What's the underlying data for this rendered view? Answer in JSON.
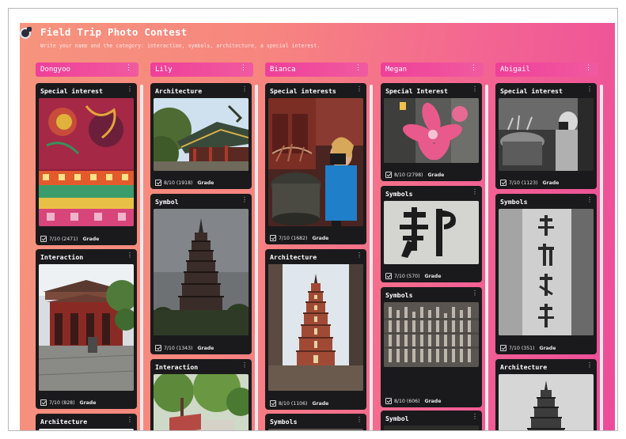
{
  "app": {
    "title": "Field Trip Photo Contest",
    "subtitle": "Write your name and the category: interaction, symbols, architecture, a special interest."
  },
  "colors": {
    "accent": "#ef3f9a",
    "card": "#1a1a1c",
    "bg_start": "#f6947d",
    "bg_end": "#ec4c9a"
  },
  "columns": [
    {
      "name": "Dongyoo",
      "posts": [
        {
          "category": "Special interest",
          "rating": "7/10 (2471)",
          "grade_label": "Grade",
          "image": "embroidered-fabric"
        },
        {
          "category": "Interaction",
          "rating": "7/10 (828)",
          "grade_label": "Grade",
          "image": "temple-courtyard"
        },
        {
          "category": "Architecture"
        }
      ]
    },
    {
      "name": "Lily",
      "posts": [
        {
          "category": "Architecture",
          "rating": "8/10 (1918)",
          "grade_label": "Grade",
          "image": "temple-roof"
        },
        {
          "category": "Symbol",
          "rating": "7/10 (1343)",
          "grade_label": "Grade",
          "image": "pagoda"
        },
        {
          "category": "Interaction",
          "image": "tree-garden"
        }
      ]
    },
    {
      "name": "Bianca",
      "posts": [
        {
          "category": "Special interests",
          "rating": "7/10 (1682)",
          "grade_label": "Grade",
          "image": "photographer-incense"
        },
        {
          "category": "Architecture",
          "rating": "8/10 (1106)",
          "grade_label": "Grade",
          "image": "pagoda-color"
        },
        {
          "category": "Symbols"
        }
      ]
    },
    {
      "name": "Megan",
      "posts": [
        {
          "category": "Special Interest",
          "rating": "8/10 (2798)",
          "grade_label": "Grade",
          "image": "pink-lily"
        },
        {
          "category": "Symbols",
          "rating": "7/10 (570)",
          "grade_label": "Grade",
          "image": "chinese-character"
        },
        {
          "category": "Symbols",
          "rating": "8/10 (606)",
          "grade_label": "Grade",
          "image": "stone-inscription"
        },
        {
          "category": "Symbol"
        }
      ]
    },
    {
      "name": "Abigail",
      "posts": [
        {
          "category": "Special interest",
          "rating": "7/10 (1123)",
          "grade_label": "Grade",
          "image": "photographer-bw"
        },
        {
          "category": "Symbols",
          "rating": "7/10 (351)",
          "grade_label": "Grade",
          "image": "stone-pillar"
        },
        {
          "category": "Architecture",
          "image": "pagoda-bw"
        }
      ]
    }
  ],
  "icons": {
    "menu": "more-vertical-icon",
    "check": "checkbox-icon",
    "app": "padlet-icon"
  },
  "menu_glyph": "⋮"
}
